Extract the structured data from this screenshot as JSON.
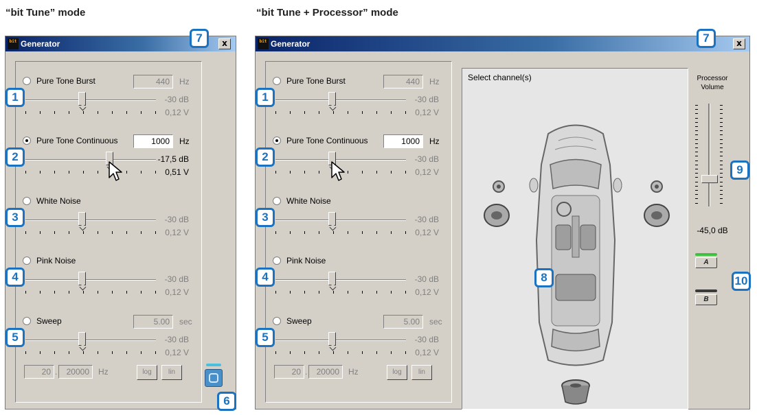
{
  "modes": {
    "left_title": "“bit Tune” mode",
    "right_title": "“bit Tune + Processor” mode"
  },
  "window": {
    "title": "Generator",
    "close_label": "x",
    "icon_label": "bit"
  },
  "generator_rows": [
    {
      "label": "Pure Tone Burst",
      "field_value": "440",
      "unit": "Hz",
      "db": "-30 dB",
      "volt": "0,12 V",
      "checked": false,
      "badge": "1"
    },
    {
      "label": "Pure Tone Continuous",
      "field_value": "1000",
      "unit": "Hz",
      "db": "-17,5 dB",
      "volt": "0,51 V",
      "checked": true,
      "badge": "2"
    },
    {
      "label": "White Noise",
      "db": "-30 dB",
      "volt": "0,12 V",
      "checked": false,
      "badge": "3"
    },
    {
      "label": "Pink Noise",
      "db": "-30 dB",
      "volt": "0,12 V",
      "checked": false,
      "badge": "4"
    },
    {
      "label": "Sweep",
      "field_value": "5.00",
      "unit": "sec",
      "db": "-30 dB",
      "volt": "0,12 V",
      "checked": false,
      "badge": "5"
    }
  ],
  "right_rows": [
    {
      "db": "-30 dB",
      "volt": "0,12 V"
    },
    {
      "db": "-30 dB",
      "volt": "0,12 V"
    },
    {
      "db": "-30 dB",
      "volt": "0,12 V"
    },
    {
      "db": "-30 dB",
      "volt": "0,12 V"
    },
    {
      "db": "-30 dB",
      "volt": "0,12 V"
    }
  ],
  "sweep_range": {
    "from": "20",
    "to": "20000",
    "unit": "Hz",
    "log_label": "log",
    "lin_label": "lin"
  },
  "channel_select": {
    "label": "Select channel(s)"
  },
  "processor": {
    "label_line1": "Processor",
    "label_line2": "Volume",
    "volume": "-45,0 dB",
    "preset_a": "A",
    "preset_b": "B"
  },
  "badges": {
    "power": "6",
    "close": "7",
    "car": "8",
    "volume": "9",
    "preset": "10"
  },
  "colors": {
    "badge_blue": "#1a72c0",
    "titlebar_dark": "#0a246a",
    "titlebar_light": "#a6caf0",
    "window_gray": "#d4d0c8",
    "led_green": "#3fbf3f",
    "power_blue": "#4a90c8"
  }
}
